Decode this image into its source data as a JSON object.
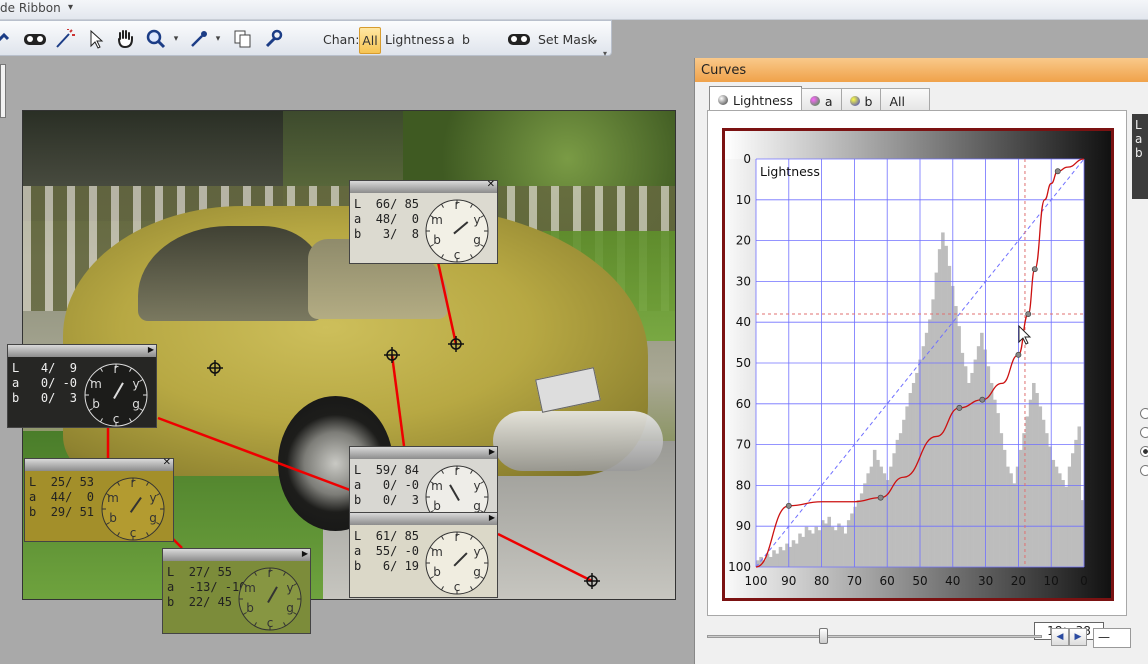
{
  "app": {
    "ribbon_title": "de Ribbon"
  },
  "toolbar": {
    "chan_label": "Chan:",
    "channels": [
      "All",
      "Lightness",
      "a",
      "b"
    ],
    "selected_channel": "All",
    "set_mask_label": "Set Mask"
  },
  "probes": [
    {
      "L": "66/ 85",
      "a": "48/  0",
      "b": " 3/  8",
      "bg": "#dcdad0",
      "clock_bg": "#f2f0e6"
    },
    {
      "L": " 4/  9",
      "a": " 0/ -0",
      "b": " 0/  3",
      "bg": "#262624",
      "clock_bg": "#1c1c1a"
    },
    {
      "L": "25/ 53",
      "a": "44/  0",
      "b": "29/ 51",
      "bg": "#a38f2a",
      "clock_bg": "#b39b30"
    },
    {
      "L": "59/ 84",
      "a": " 0/ -0",
      "b": " 0/  3",
      "bg": "#d8d7d2",
      "clock_bg": "#eeede8"
    },
    {
      "L": "61/ 85",
      "a": "55/ -0",
      "b": " 6/ 19",
      "bg": "#dbd8c8",
      "clock_bg": "#f0ede0"
    },
    {
      "L": "27/ 55",
      "a": "-13/ -10",
      "b": "22/ 45",
      "bg": "#7c8c3a",
      "clock_bg": "#879642"
    }
  ],
  "clock_labels": {
    "top": "r",
    "left": "m",
    "right": "y",
    "bl": "b",
    "br": "g",
    "bottom": "c"
  },
  "row_labels": {
    "L": "L",
    "a": "a",
    "b": "b"
  },
  "curves": {
    "title": "Curves",
    "tabs": [
      {
        "label": "Lightness",
        "active": true
      },
      {
        "label": "a",
        "active": false
      },
      {
        "label": "b",
        "active": false
      },
      {
        "label": "All",
        "active": false
      }
    ],
    "plot_label": "Lightness",
    "x_ticks": [
      "100",
      "90",
      "80",
      "70",
      "60",
      "50",
      "40",
      "30",
      "20",
      "10",
      "0"
    ],
    "y_ticks": [
      "0",
      "10",
      "20",
      "30",
      "40",
      "50",
      "60",
      "70",
      "80",
      "90",
      "100"
    ],
    "readout_in": "18",
    "readout_out": "38",
    "side_labels": [
      "L",
      "a",
      "b"
    ],
    "curve_points": [
      [
        100,
        100
      ],
      [
        90,
        85
      ],
      [
        80,
        84
      ],
      [
        70,
        84
      ],
      [
        62,
        83
      ],
      [
        55,
        78
      ],
      [
        45,
        68
      ],
      [
        38,
        61
      ],
      [
        31,
        59
      ],
      [
        25,
        55
      ],
      [
        20,
        48
      ],
      [
        17,
        38
      ],
      [
        15,
        27
      ],
      [
        12,
        10
      ],
      [
        10,
        6
      ],
      [
        8,
        3
      ],
      [
        5,
        2
      ],
      [
        0,
        0
      ]
    ],
    "histogram": [
      2,
      3,
      2,
      4,
      3,
      5,
      4,
      6,
      5,
      7,
      6,
      8,
      7,
      10,
      9,
      12,
      11,
      10,
      12,
      11,
      14,
      13,
      15,
      12,
      11,
      13,
      12,
      10,
      14,
      16,
      18,
      20,
      22,
      25,
      28,
      30,
      35,
      32,
      30,
      28,
      26,
      30,
      34,
      38,
      40,
      44,
      48,
      52,
      55,
      58,
      62,
      66,
      70,
      74,
      80,
      88,
      95,
      100,
      96,
      90,
      84,
      78,
      72,
      64,
      60,
      55,
      58,
      62,
      66,
      70,
      65,
      60,
      55,
      50,
      46,
      40,
      35,
      30,
      28,
      25,
      30,
      35,
      40,
      45,
      50,
      55,
      52,
      48,
      44,
      40,
      36,
      32,
      30,
      28,
      26,
      24,
      30,
      34,
      38,
      42,
      20
    ],
    "colors": {
      "curve": "#cc1111",
      "grid": "#7070ff",
      "frame": "#7b1212",
      "histogram": "#bdbdbd",
      "tab_title": "#f0a24a"
    }
  },
  "number_box": "—"
}
